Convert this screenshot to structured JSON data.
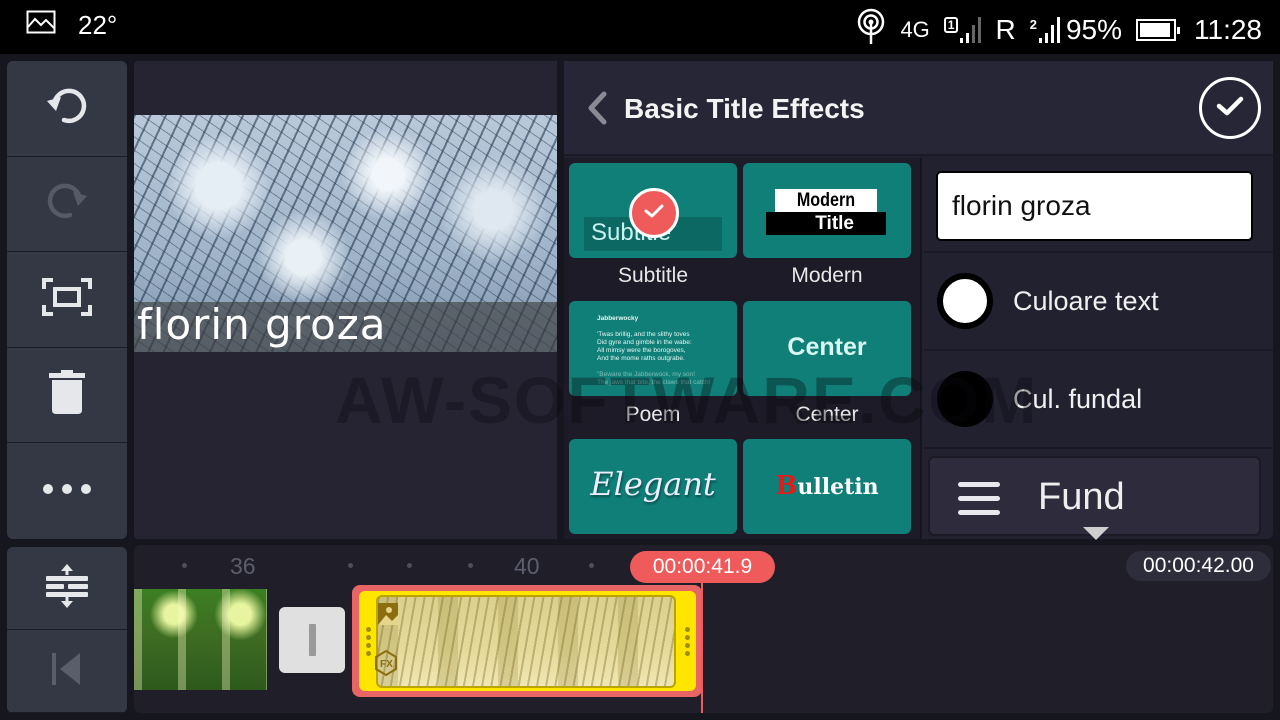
{
  "status_bar": {
    "temperature": "22°",
    "network_type": "4G",
    "sim1_label": "1",
    "roaming": "R",
    "sim2_label": "2",
    "battery_percent": "95%",
    "battery_level": 0.95,
    "time": "11:28"
  },
  "left_toolbar": {
    "items": [
      {
        "name": "undo",
        "icon": "undo-icon",
        "enabled": true
      },
      {
        "name": "redo",
        "icon": "redo-icon",
        "enabled": false
      },
      {
        "name": "fit-screen",
        "icon": "fit-screen-icon",
        "enabled": true
      },
      {
        "name": "delete",
        "icon": "trash-icon",
        "enabled": true
      },
      {
        "name": "more",
        "icon": "more-horizontal-icon",
        "enabled": true
      }
    ]
  },
  "preview": {
    "subtitle_text": "florin groza"
  },
  "watermark": "AW-SOFTWARE.COM",
  "effects_panel": {
    "title": "Basic Title Effects",
    "back_icon": "chevron-left-icon",
    "confirm_icon": "check-circle-icon",
    "effects": [
      {
        "label": "Subtitle",
        "preview_text": "Subtitle",
        "selected": true
      },
      {
        "label": "Modern",
        "preview_line1": "Modern",
        "preview_line2": "Title",
        "selected": false
      },
      {
        "label": "Poem",
        "selected": false,
        "preview_lines": [
          "Jabberwocky",
          "",
          "'Twas brillig, and the slithy toves",
          "Did gyre and gimble in the wabe:",
          "All mimsy were the borogoves,",
          "And the mome raths outgrabe.",
          "",
          "\"Beware the Jabberwock, my son!",
          "The jaws that bite, the claws that catch!"
        ]
      },
      {
        "label": "Center",
        "preview_text": "Center",
        "selected": false
      },
      {
        "label": "Elegant",
        "preview_text": "Elegant",
        "selected": false
      },
      {
        "label": "Bulletin",
        "preview_initial": "B",
        "preview_rest": "ulletin",
        "selected": false
      }
    ]
  },
  "text_controls": {
    "text_value": "florin groza",
    "text_color_label": "Culoare text",
    "text_color": "#ffffff",
    "bg_color_label": "Cul. fundal",
    "bg_color": "#000000",
    "dropdown_label": "Fund"
  },
  "timeline": {
    "ruler_labels": [
      "36",
      "40"
    ],
    "current_time": "00:00:41.9",
    "total_duration": "00:00:42.00"
  },
  "timeline_tools": {
    "items": [
      {
        "name": "expand-tracks",
        "icon": "expand-tracks-icon",
        "enabled": true
      },
      {
        "name": "jump-start",
        "icon": "skip-to-start-icon",
        "enabled": false
      }
    ]
  },
  "colors": {
    "accent_red": "#ef5a5a",
    "tile_teal": "#0f7f78",
    "clip_yellow": "#ffe500"
  }
}
